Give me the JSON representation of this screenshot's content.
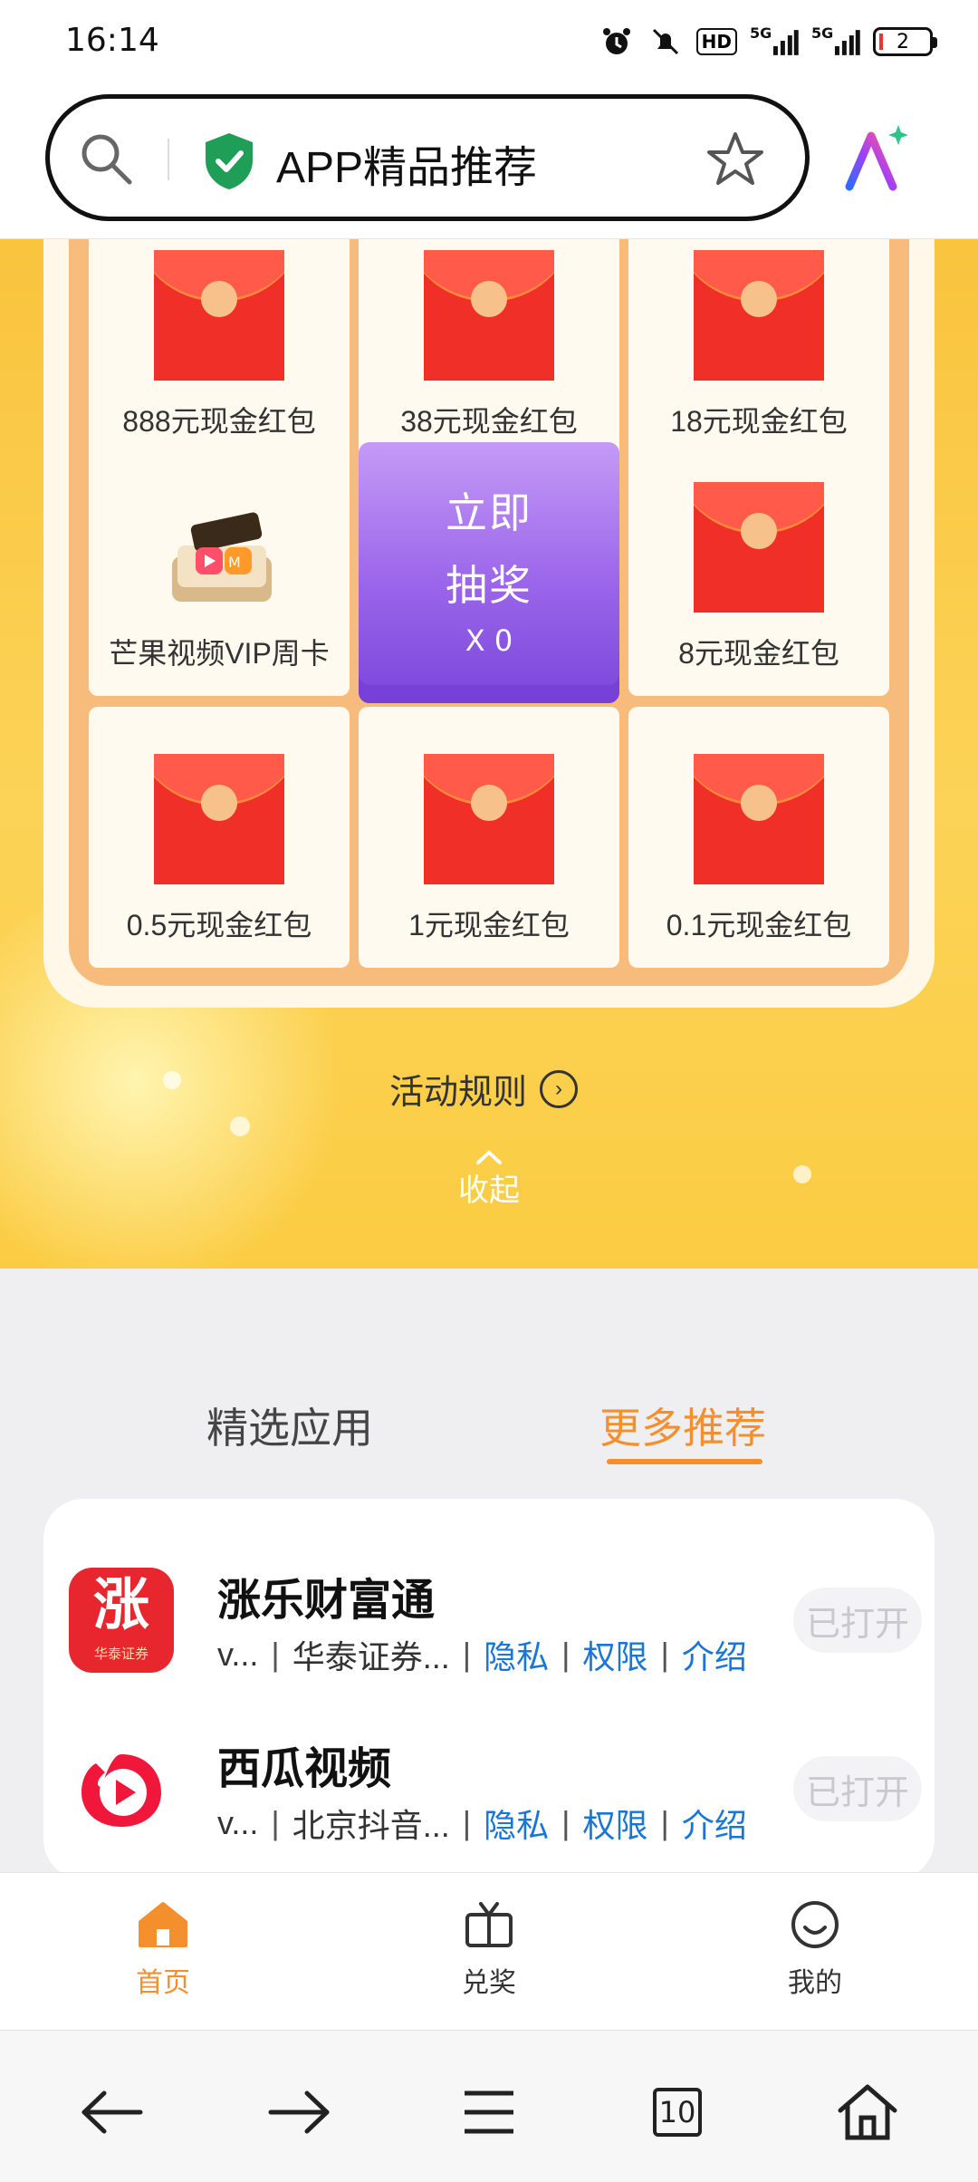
{
  "status_bar": {
    "time": "16:14",
    "hd_badge": "HD",
    "signal1": "5G",
    "signal2": "5G",
    "battery": "2"
  },
  "search_bar": {
    "title": "APP精品推荐"
  },
  "prize_grid": {
    "cells": [
      {
        "label": "888元现金红包",
        "icon": "red-envelope-icon"
      },
      {
        "label": "38元现金红包",
        "icon": "red-envelope-icon"
      },
      {
        "label": "18元现金红包",
        "icon": "red-envelope-icon"
      },
      {
        "label": "芒果视频VIP周卡",
        "icon": "mango-video-vip-icon"
      },
      {
        "label": "8元现金红包",
        "icon": "red-envelope-icon"
      },
      {
        "label": "0.5元现金红包",
        "icon": "red-envelope-icon"
      },
      {
        "label": "1元现金红包",
        "icon": "red-envelope-icon"
      },
      {
        "label": "0.1元现金红包",
        "icon": "red-envelope-icon"
      }
    ],
    "draw_button": {
      "line1": "立即",
      "line2": "抽奖",
      "count": "X 0"
    }
  },
  "rules_link": "活动规则",
  "collapse_label": "收起",
  "tabs": [
    {
      "label": "精选应用",
      "active": false
    },
    {
      "label": "更多推荐",
      "active": true
    }
  ],
  "apps": [
    {
      "name": "涨乐财富通",
      "version": "v...",
      "developer": "华泰证券...",
      "privacy": "隐私",
      "permissions": "权限",
      "intro": "介绍",
      "button": "已打开",
      "icon_text": "涨",
      "icon_subtext": "华泰证券"
    },
    {
      "name": "西瓜视频",
      "version": "v...",
      "developer": "北京抖音...",
      "privacy": "隐私",
      "permissions": "权限",
      "intro": "介绍",
      "button": "已打开"
    }
  ],
  "bottom_nav": [
    {
      "label": "首页",
      "icon": "home-icon",
      "active": true
    },
    {
      "label": "兑奖",
      "icon": "tv-gift-icon",
      "active": false
    },
    {
      "label": "我的",
      "icon": "smile-icon",
      "active": false
    }
  ],
  "browser_toolbar": {
    "tab_count": "10"
  },
  "colors": {
    "accent_orange": "#f3902d",
    "link_blue": "#1876d8",
    "envelope_red": "#f03028",
    "draw_purple": "#9a65ea"
  }
}
